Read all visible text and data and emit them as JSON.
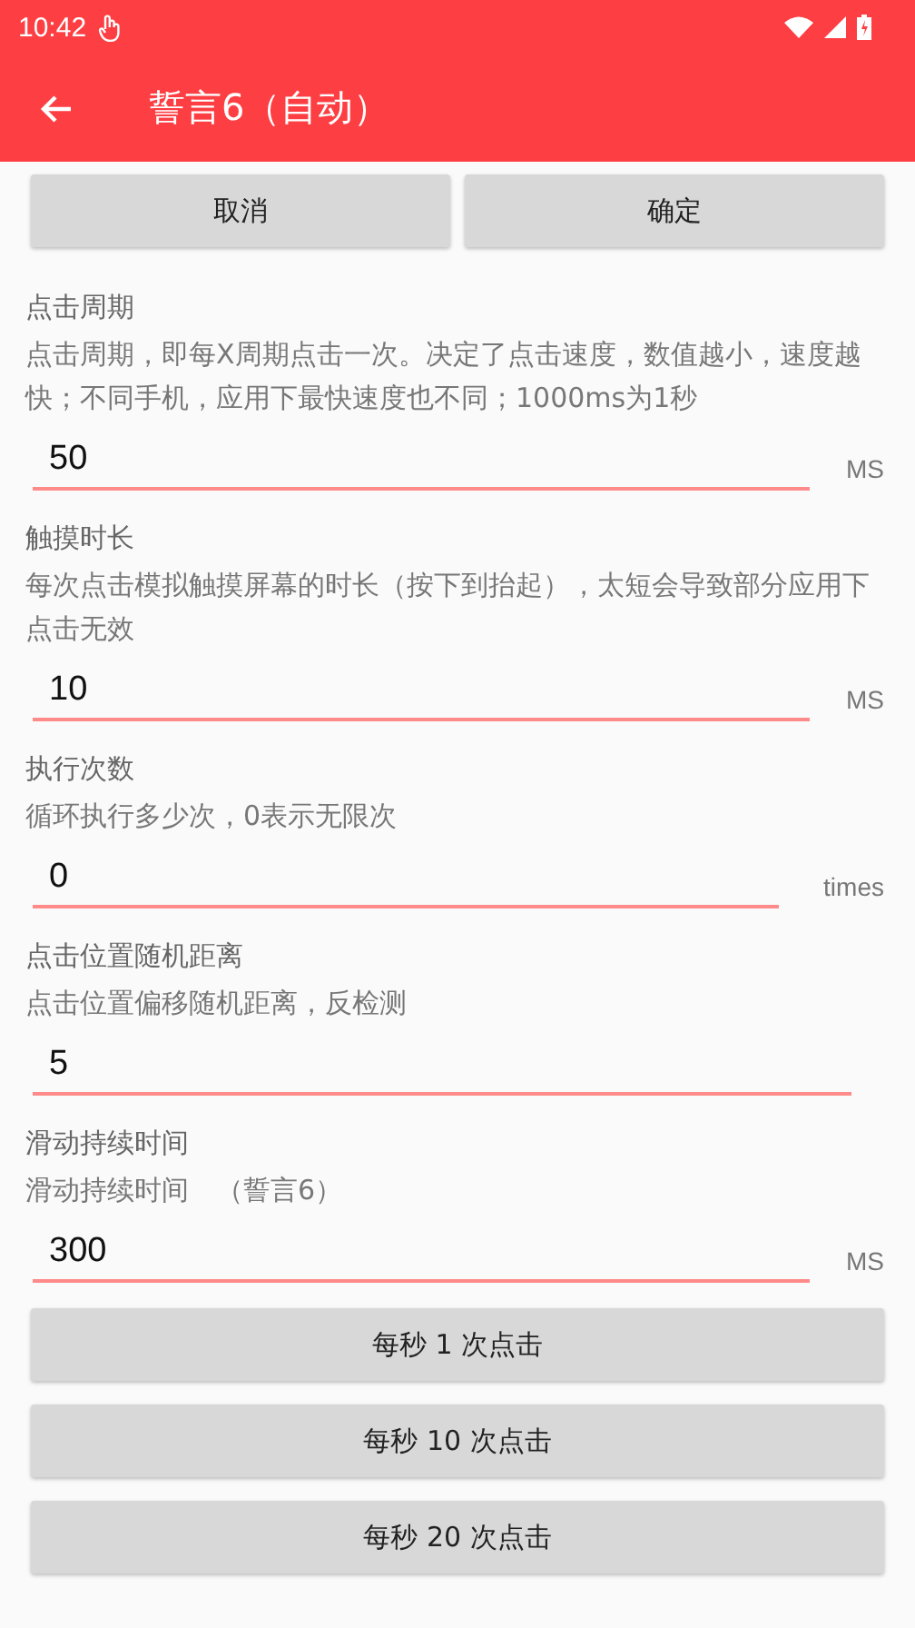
{
  "status_bar": {
    "time": "10:42"
  },
  "app_bar": {
    "title": "誓言6（自动）"
  },
  "top_buttons": [
    "取消",
    "确定"
  ],
  "settings": [
    {
      "title": "点击周期",
      "description": "点击周期，即每X周期点击一次。决定了点击速度，数值越小，速度越快；不同手机，应用下最快速度也不同；1000ms为1秒",
      "value": "50",
      "unit": "MS"
    },
    {
      "title": "触摸时长",
      "description": "每次点击模拟触摸屏幕的时长（按下到抬起），太短会导致部分应用下点击无效",
      "value": "10",
      "unit": "MS"
    },
    {
      "title": "执行次数",
      "description": "循环执行多少次，0表示无限次",
      "value": "0",
      "unit": "times"
    },
    {
      "title": "点击位置随机距离",
      "description": "点击位置偏移随机距离，反检测",
      "value": "5"
    },
    {
      "title": "滑动持续时间",
      "description": "滑动持续时间　（誓言6）",
      "value": "300",
      "unit": "MS"
    }
  ],
  "preset_buttons": [
    "每秒 1 次点击",
    "每秒 10 次点击",
    "每秒 20 次点击"
  ]
}
